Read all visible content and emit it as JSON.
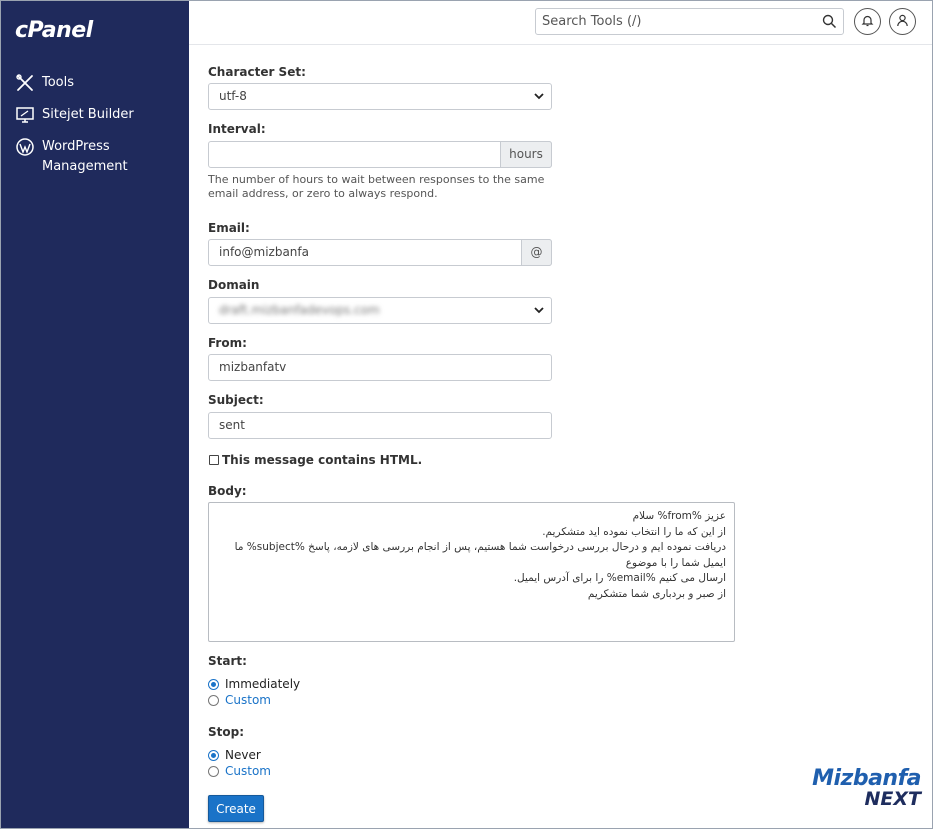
{
  "brand": {
    "logo_text": "cPanel"
  },
  "sidebar": {
    "items": [
      {
        "label": "Tools",
        "icon": "tools-icon"
      },
      {
        "label": "Sitejet Builder",
        "icon": "monitor-icon"
      },
      {
        "label": "WordPress Management",
        "icon": "wordpress-icon"
      }
    ]
  },
  "header": {
    "search_placeholder": "Search Tools (/)",
    "notification_icon": "bell-icon",
    "user_icon": "user-icon"
  },
  "form": {
    "charset": {
      "label": "Character Set:",
      "value": "utf-8"
    },
    "interval": {
      "label": "Interval:",
      "value": "",
      "addon": "hours",
      "help": "The number of hours to wait between responses to the same email address, or zero to always respond."
    },
    "email": {
      "label": "Email:",
      "value": "info@mizbanfa",
      "addon": "@"
    },
    "domain": {
      "label": "Domain",
      "value": "draft.mizbanfadevops.com"
    },
    "from": {
      "label": "From:",
      "value": "mizbanfatv"
    },
    "subject": {
      "label": "Subject:",
      "value": "sent"
    },
    "html_checkbox": {
      "label": "This message contains HTML.",
      "checked": false
    },
    "body": {
      "label": "Body:",
      "lines": [
        "عزیز %from% سلام",
        "از این که ما را انتخاب نموده اید متشکریم.",
        "دریافت نموده ایم و درحال بررسی درخواست شما هستیم، پس از انجام بررسی های لازمه، پاسخ %subject% ما ایمیل شما را با موضوع",
        "ارسال می کنیم %email% را برای آدرس ایمیل.",
        "از صبر و بردباری شما متشکریم"
      ]
    },
    "start": {
      "label": "Start:",
      "options": [
        "Immediately",
        "Custom"
      ],
      "selected": "Immediately"
    },
    "stop": {
      "label": "Stop:",
      "options": [
        "Never",
        "Custom"
      ],
      "selected": "Never"
    },
    "submit_label": "Create"
  },
  "watermark": {
    "brand": "Mizbanfa",
    "suffix": "NEXT"
  },
  "colors": {
    "sidebar": "#1f2a5c",
    "accent": "#1a73c8"
  }
}
